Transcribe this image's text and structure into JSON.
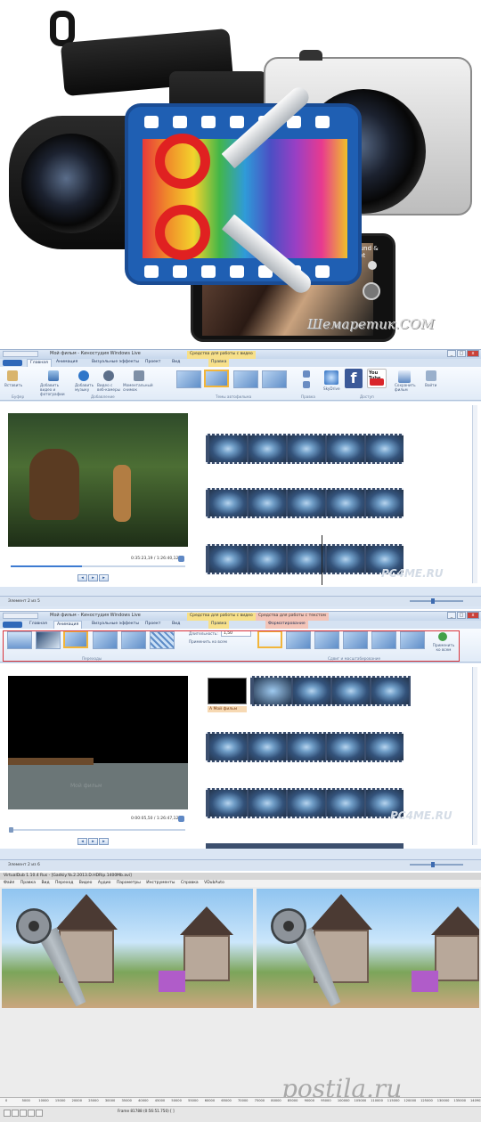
{
  "hero": {
    "phone_label": "Sound & shot",
    "watermark": "Шемаретик.COM"
  },
  "wml1": {
    "title": "Мой фильм - Киностудия Windows Live",
    "context_tab": "Средства для работы с видео",
    "tabs": [
      "Главная",
      "Анимация",
      "Визуальные эффекты",
      "Проект",
      "Вид",
      "Правка"
    ],
    "ribbon": {
      "paste": "Вставить",
      "add_video": "Добавить видео и фотографии",
      "add_music": "Добавить музыку",
      "webcam": "Видео с веб-камеры",
      "snapshot": "Моментальный снимок",
      "skydrive": "SkyDrive",
      "youtube": "You Tube",
      "save_movie": "Сохранить фильм",
      "signin": "Войти",
      "groups": [
        "Буфер",
        "Добавление",
        "Темы автофильма",
        "Правка",
        "Доступ"
      ]
    },
    "timecode": "0:35:23,19 / 1:26:40,12",
    "status": "Элемент 2 из 5",
    "watermark": "PC4ME.RU",
    "seek_fraction": 0.41
  },
  "wml2": {
    "title": "Мой фильм - Киностудия Windows Live",
    "context_tab_video": "Средства для работы с видео",
    "context_tab_text": "Средства для работы с текстом",
    "tabs": [
      "Главная",
      "Анимация",
      "Визуальные эффекты",
      "Проект",
      "Вид",
      "Правка",
      "Форматирование"
    ],
    "ribbon": {
      "duration_label": "Длительность:",
      "duration_value": "1,50",
      "apply_all": "Применить ко всем",
      "apply_all_right": "Применить ко всем",
      "groups": [
        "Переходы",
        "Сдвиг и масштабирование"
      ]
    },
    "title_clip": "A Мой фильм",
    "preview_text": "Мой фильм",
    "timecode": "0:00:05,50 / 1:26:47,12",
    "status": "Элемент 2 из 6",
    "watermark": "PC4ME.RU",
    "seek_fraction": 0.0
  },
  "vdub": {
    "title": "VirtualDub 1.10.4 Rus - [Gadkiy.Ya.2.2013.D.HDRip.1400Mb.avi]",
    "menu": [
      "Файл",
      "Правка",
      "Вид",
      "Переход",
      "Видео",
      "Аудио",
      "Параметры",
      "Инструменты",
      "Справка",
      "VDubAuto"
    ],
    "ruler": [
      "0",
      "5000",
      "10000",
      "15000",
      "20000",
      "25000",
      "30000",
      "35000",
      "40000",
      "45000",
      "50000",
      "55000",
      "60000",
      "65000",
      "70000",
      "75000",
      "80000",
      "85000",
      "90000",
      "95000",
      "100000",
      "105000",
      "110000",
      "115000",
      "120000",
      "125000",
      "130000",
      "135000",
      "140903"
    ],
    "frame_status": "Frame 81788 (0:56:51.750) [ ]",
    "watermark": "postila.ru"
  }
}
